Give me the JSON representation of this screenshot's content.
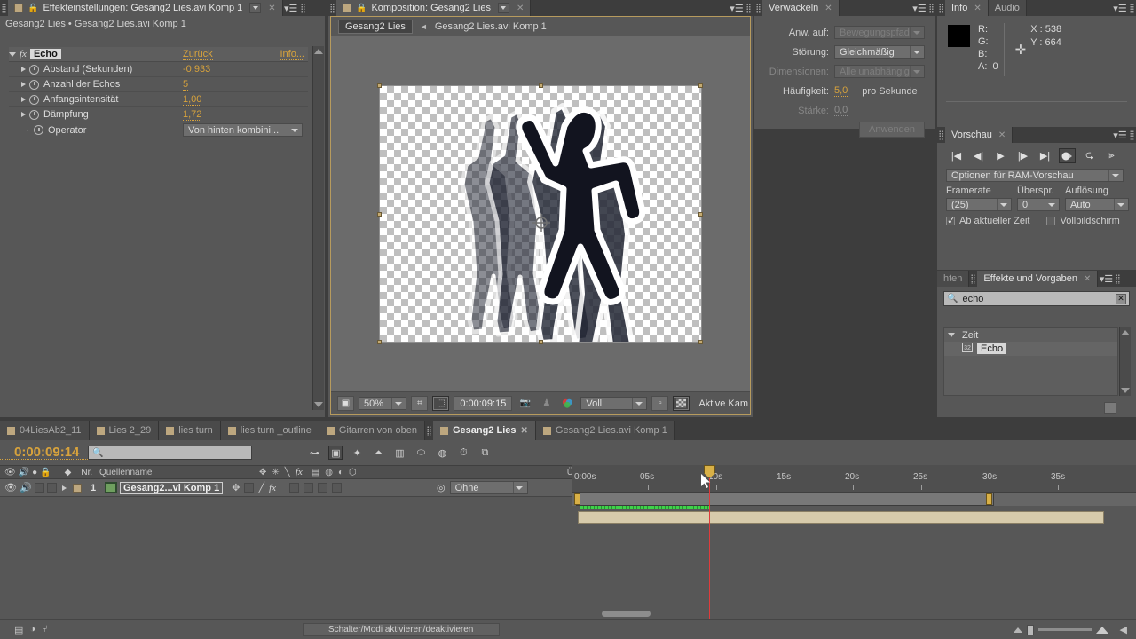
{
  "effect_controls": {
    "tab_title": "Effekteinstellungen: Gesang2 Lies.avi Komp 1",
    "subtitle": "Gesang2 Lies • Gesang2 Lies.avi Komp 1",
    "effect_name": "Echo",
    "reset_label": "Zurück",
    "info_label": "Info...",
    "properties": [
      {
        "label": "Abstand (Sekunden)",
        "value": "-0,933"
      },
      {
        "label": "Anzahl der Echos",
        "value": "5"
      },
      {
        "label": "Anfangsintensität",
        "value": "1,00"
      },
      {
        "label": "Dämpfung",
        "value": "1,72"
      },
      {
        "label": "Operator",
        "value": "Von hinten kombini..."
      }
    ]
  },
  "composition": {
    "tab_title": "Komposition: Gesang2 Lies",
    "breadcrumb_button": "Gesang2 Lies",
    "breadcrumb_current": "Gesang2 Lies.avi Komp 1",
    "toolbar": {
      "zoom": "50%",
      "timecode": "0:00:09:15",
      "quality": "Voll",
      "camera": "Aktive Kam"
    }
  },
  "wiggler": {
    "tab_title": "Verwackeln",
    "apply_to_label": "Anw. auf:",
    "apply_to_value": "Bewegungspfad",
    "noise_label": "Störung:",
    "noise_value": "Gleichmäßig",
    "dimensions_label": "Dimensionen:",
    "dimensions_value": "Alle unabhängig",
    "frequency_label": "Häufigkeit:",
    "frequency_value": "5,0",
    "frequency_unit": "pro Sekunde",
    "magnitude_label": "Stärke:",
    "magnitude_value": "0,0",
    "apply_button": "Anwenden"
  },
  "info": {
    "tab_title": "Info",
    "audio_tab": "Audio",
    "r_label": "R:",
    "g_label": "G:",
    "b_label": "B:",
    "a_label": "A:",
    "a_value": "0",
    "x_value": "X : 538",
    "y_value": "Y : 664",
    "swatch_color": "#000000"
  },
  "preview": {
    "tab_title": "Vorschau",
    "ram_options": "Optionen für RAM-Vorschau",
    "framerate_label": "Framerate",
    "framerate_value": "(25)",
    "skip_label": "Überspr.",
    "skip_value": "0",
    "resolution_label": "Auflösung",
    "resolution_value": "Auto",
    "from_current_time": "Ab aktueller Zeit",
    "fullscreen": "Vollbildschirm"
  },
  "effects_presets": {
    "ghost_tab": "hten",
    "tab_title": "Effekte und Vorgaben",
    "search_value": "echo",
    "category": "Zeit",
    "item": "Echo"
  },
  "timeline": {
    "tabs": [
      {
        "label": "04LiesAb2_11",
        "active": false
      },
      {
        "label": "Lies 2_29",
        "active": false
      },
      {
        "label": "lies turn",
        "active": false
      },
      {
        "label": "lies turn _outline",
        "active": false
      },
      {
        "label": "Gitarren von oben",
        "active": false
      },
      {
        "label": "Gesang2 Lies",
        "active": true
      },
      {
        "label": "Gesang2 Lies.avi Komp 1",
        "active": false
      }
    ],
    "timecode": "0:00:09:14",
    "search_placeholder": "",
    "columns": {
      "number": "Nr.",
      "source_name": "Quellenname",
      "parent": "Übergeordnet"
    },
    "layer": {
      "index": "1",
      "name": "Gesang2...vi Komp 1",
      "parent_value": "Ohne"
    },
    "ruler_ticks": [
      "0:00s",
      "05s",
      "10s",
      "15s",
      "20s",
      "25s",
      "30s",
      "35s"
    ],
    "switches_modes_button": "Schalter/Modi aktivieren/deaktivieren"
  },
  "colors": {
    "panel_bg": "#575757",
    "accent_value": "#d8a33c",
    "highlight_border": "#b79b5e",
    "render_green": "#3fd24a",
    "cti_red": "#e03b3b"
  }
}
